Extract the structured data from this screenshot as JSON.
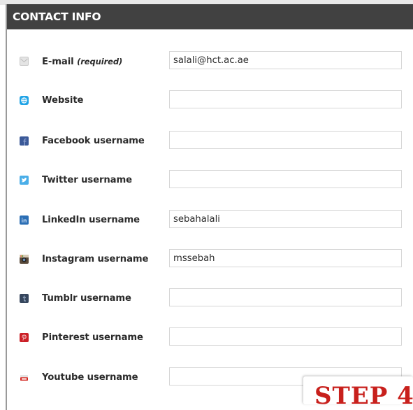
{
  "header": {
    "title": "CONTACT INFO"
  },
  "fields": [
    {
      "label": "E-mail",
      "required": "(required)",
      "icon": "envelope-icon",
      "value": "salali@hct.ac.ae"
    },
    {
      "label": "Website",
      "icon": "globe-icon",
      "value": ""
    },
    {
      "label": "Facebook username",
      "icon": "facebook-icon",
      "value": ""
    },
    {
      "label": "Twitter username",
      "icon": "twitter-icon",
      "value": ""
    },
    {
      "label": "LinkedIn username",
      "icon": "linkedin-icon",
      "value": "sebahalali"
    },
    {
      "label": "Instagram username",
      "icon": "instagram-icon",
      "value": "mssebah"
    },
    {
      "label": "Tumblr username",
      "icon": "tumblr-icon",
      "value": ""
    },
    {
      "label": "Pinterest username",
      "icon": "pinterest-icon",
      "value": ""
    },
    {
      "label": "Youtube username",
      "icon": "youtube-icon",
      "value": ""
    }
  ],
  "overlay": {
    "step_text": "STEP 4"
  },
  "colors": {
    "header_bg": "#414141",
    "step_red": "#c8201c",
    "facebook": "#3b5998",
    "twitter": "#4aaee8",
    "linkedin": "#2c6fb5",
    "pinterest": "#cb2027",
    "website": "#1fa3e6"
  }
}
